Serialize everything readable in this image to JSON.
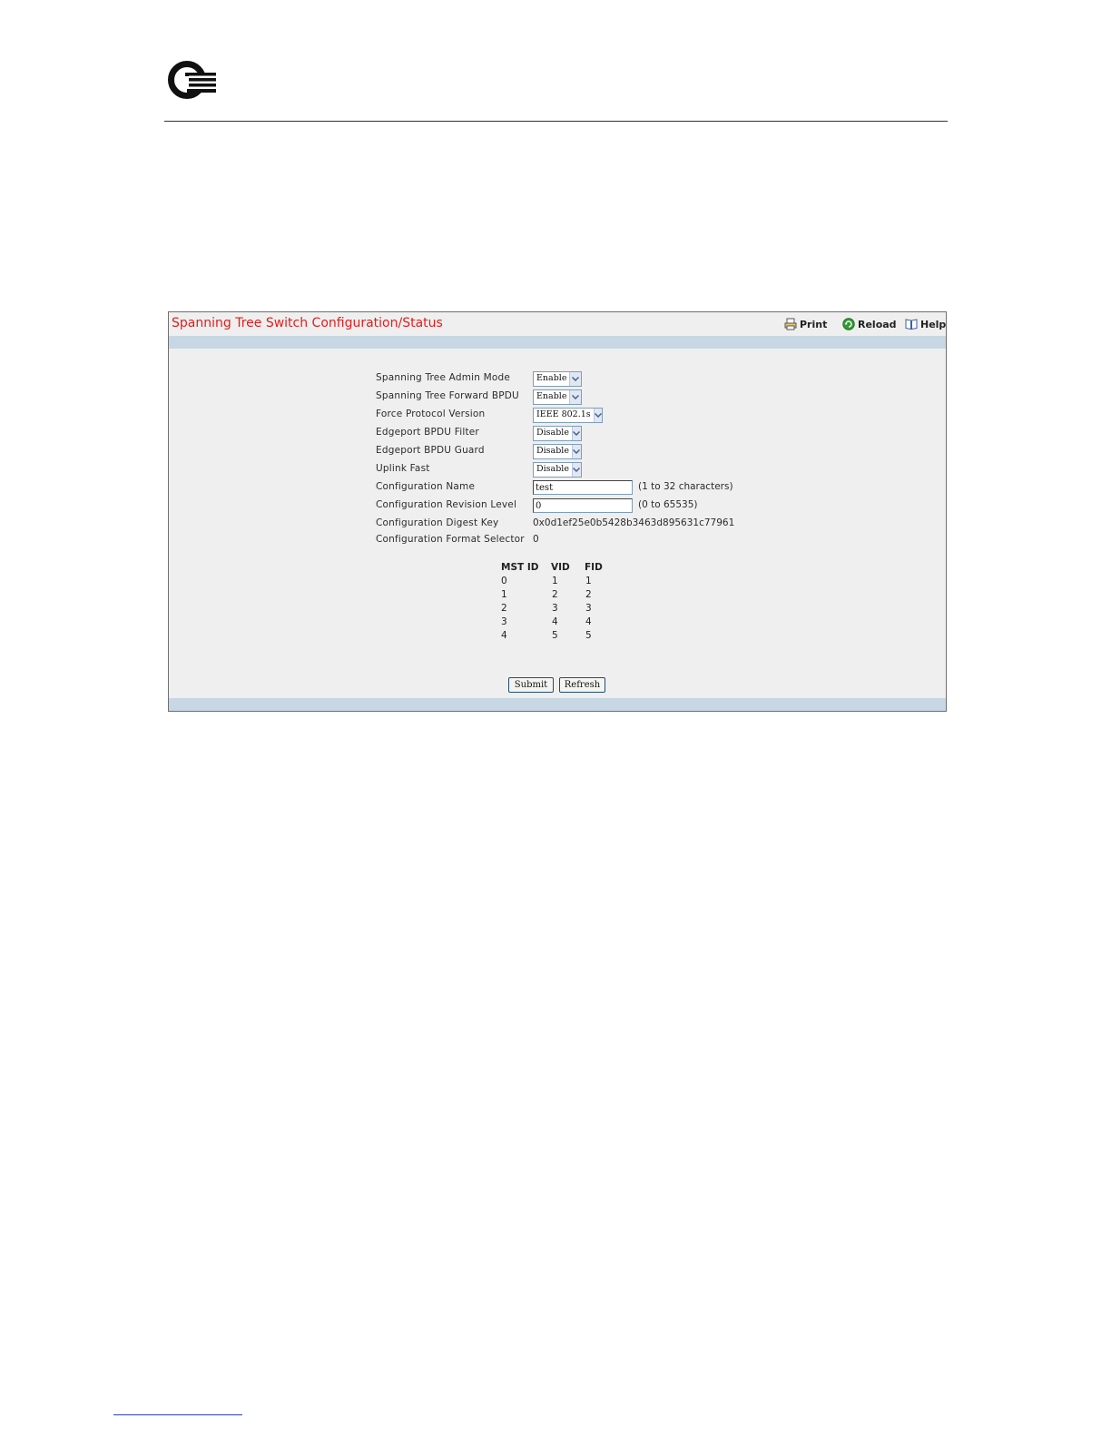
{
  "page": {
    "logo_icon": "qlogic-logo-icon",
    "colors": {
      "title": "#e21c1c",
      "band": "#c7d7e3",
      "panel_bg": "#efefef",
      "reload_icon": "#2e9b2e"
    }
  },
  "panel": {
    "title": "Spanning Tree Switch Configuration/Status",
    "toolbar": {
      "print_label": "Print",
      "reload_label": "Reload",
      "help_label": "Help"
    }
  },
  "form": {
    "admin_mode": {
      "label": "Spanning Tree Admin Mode",
      "value": "Enable"
    },
    "forward_bpdu": {
      "label": "Spanning Tree Forward BPDU",
      "value": "Enable"
    },
    "force_protocol": {
      "label": "Force Protocol Version",
      "value": "IEEE 802.1s"
    },
    "edgeport_filter": {
      "label": "Edgeport BPDU Filter",
      "value": "Disable"
    },
    "edgeport_guard": {
      "label": "Edgeport BPDU Guard",
      "value": "Disable"
    },
    "uplink_fast": {
      "label": "Uplink Fast",
      "value": "Disable"
    },
    "config_name": {
      "label": "Configuration Name",
      "value": "test",
      "hint": "(1 to 32 characters)"
    },
    "revision_level": {
      "label": "Configuration Revision Level",
      "value": "0",
      "hint": "(0 to 65535)"
    },
    "digest_key": {
      "label": "Configuration Digest Key",
      "value": "0x0d1ef25e0b5428b3463d895631c77961"
    },
    "format_selector": {
      "label": "Configuration Format Selector",
      "value": "0"
    }
  },
  "mst_table": {
    "headers": [
      "MST ID",
      "VID",
      "FID"
    ],
    "rows": [
      [
        "0",
        "1",
        "1"
      ],
      [
        "1",
        "2",
        "2"
      ],
      [
        "2",
        "3",
        "3"
      ],
      [
        "3",
        "4",
        "4"
      ],
      [
        "4",
        "5",
        "5"
      ]
    ]
  },
  "buttons": {
    "submit_label": "Submit",
    "refresh_label": "Refresh"
  }
}
